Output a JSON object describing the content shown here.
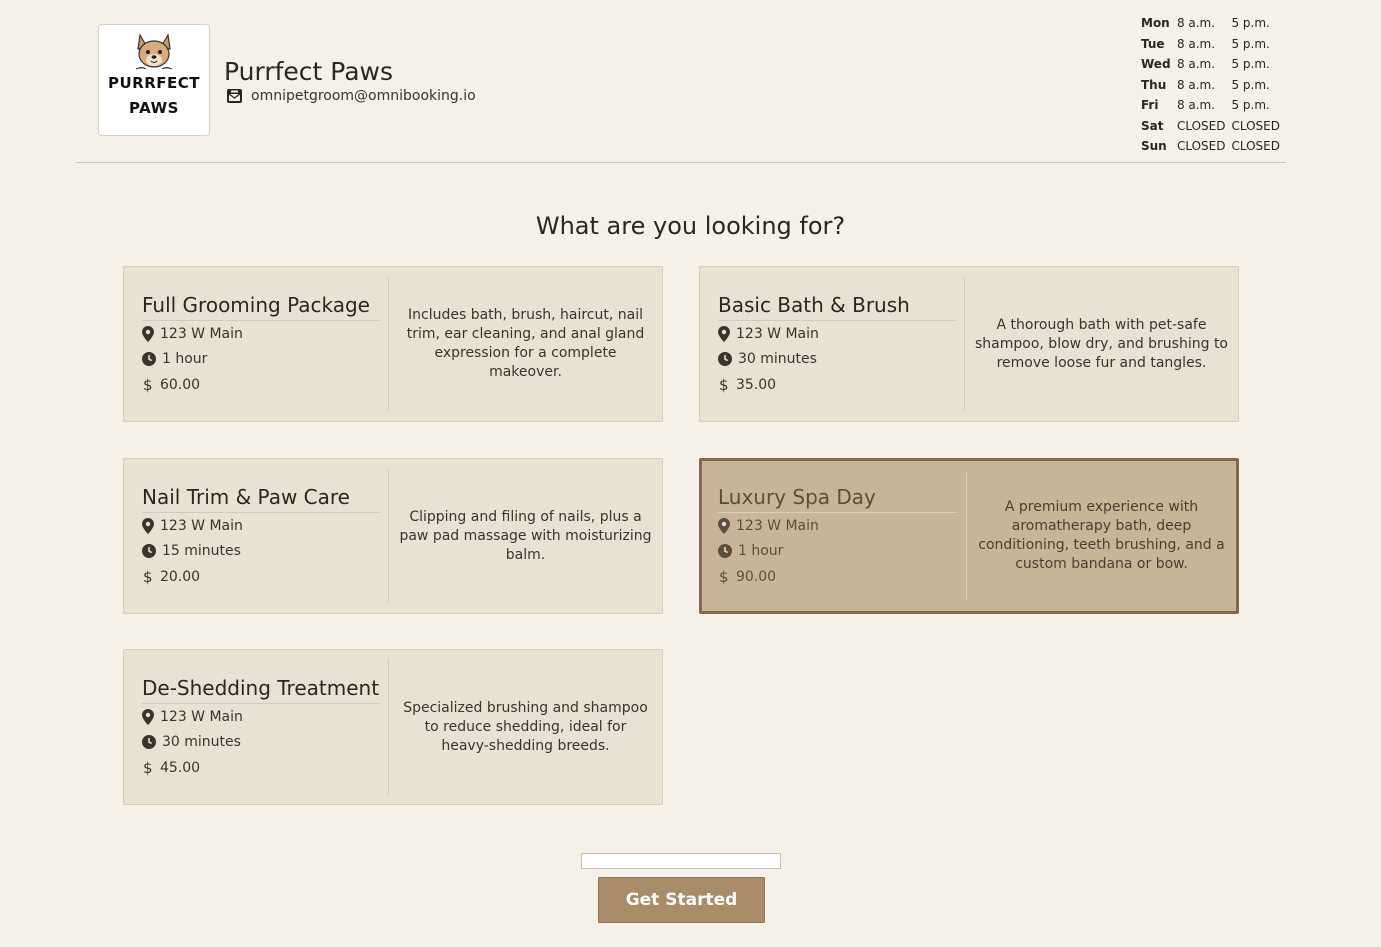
{
  "business": {
    "logo_line1": "PURRFECT",
    "logo_line2": "PAWS",
    "name": "Purrfect Paws",
    "email": "omnipetgroom@omnibooking.io"
  },
  "hours": [
    {
      "day": "Mon",
      "open": "8 a.m.",
      "close": "5 p.m."
    },
    {
      "day": "Tue",
      "open": "8 a.m.",
      "close": "5 p.m."
    },
    {
      "day": "Wed",
      "open": "8 a.m.",
      "close": "5 p.m."
    },
    {
      "day": "Thu",
      "open": "8 a.m.",
      "close": "5 p.m."
    },
    {
      "day": "Fri",
      "open": "8 a.m.",
      "close": "5 p.m."
    },
    {
      "day": "Sat",
      "open": "CLOSED",
      "close": "CLOSED"
    },
    {
      "day": "Sun",
      "open": "CLOSED",
      "close": "CLOSED"
    }
  ],
  "main": {
    "title": "What are you looking for?"
  },
  "services": [
    {
      "name": "Full Grooming Package",
      "location": "123 W Main",
      "duration": "1 hour",
      "price": "60.00",
      "description": "Includes bath, brush, haircut, nail trim, ear cleaning, and anal gland expression for a complete makeover."
    },
    {
      "name": "Basic Bath & Brush",
      "location": "123 W Main",
      "duration": "30 minutes",
      "price": "35.00",
      "description": "A thorough bath with pet-safe shampoo, blow dry, and brushing to remove loose fur and tangles."
    },
    {
      "name": "Nail Trim & Paw Care",
      "location": "123 W Main",
      "duration": "15 minutes",
      "price": "20.00",
      "description": "Clipping and filing of nails, plus a paw pad massage with moisturizing balm."
    },
    {
      "name": "Luxury Spa Day",
      "location": "123 W Main",
      "duration": "1 hour",
      "price": "90.00",
      "description": "A premium experience with aromatherapy bath, deep conditioning, teeth brushing, and a custom bandana or bow."
    },
    {
      "name": "De-Shedding Treatment",
      "location": "123 W Main",
      "duration": "30 minutes",
      "price": "45.00",
      "description": "Specialized brushing and shampoo to reduce shedding, ideal for heavy-shedding breeds."
    }
  ],
  "footer": {
    "search_value": "",
    "cta_label": "Get Started"
  },
  "colors": {
    "background": "#f5f0e8",
    "card": "#e8e1d4",
    "card_selected": "#c8b597",
    "accent": "#a98c68"
  },
  "icons": {
    "email": "envelope-icon",
    "location": "map-pin-icon",
    "duration": "clock-icon",
    "price": "dollar-icon"
  }
}
